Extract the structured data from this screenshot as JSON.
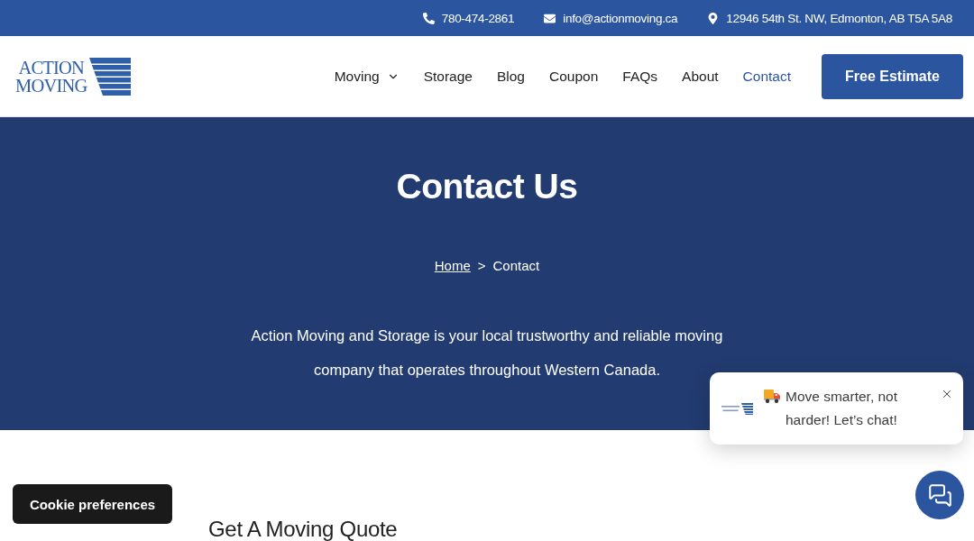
{
  "top_bar": {
    "contacts": [
      {
        "kind": "phone",
        "text": "780-474-2861"
      },
      {
        "kind": "email",
        "text": "info@actionmoving.ca"
      },
      {
        "kind": "location",
        "text": "12946 54th St. NW, Edmonton, AB T5A 5A8"
      }
    ]
  },
  "header": {
    "logo": {
      "lines": [
        "ACTION",
        "MOVING"
      ]
    },
    "nav": [
      {
        "label": "Moving",
        "dropdown": true,
        "selected": false
      },
      {
        "label": "Storage",
        "dropdown": false,
        "selected": false
      },
      {
        "label": "Blog",
        "dropdown": false,
        "selected": false
      },
      {
        "label": "Coupon",
        "dropdown": false,
        "selected": false
      },
      {
        "label": "FAQs",
        "dropdown": false,
        "selected": false
      },
      {
        "label": "About",
        "dropdown": false,
        "selected": false
      },
      {
        "label": "Contact",
        "dropdown": false,
        "selected": true
      }
    ],
    "cta": "Free Estimate"
  },
  "hero": {
    "title": "Contact Us",
    "breadcrumb": [
      {
        "kind": "link",
        "label": "Home"
      },
      {
        "kind": "separator",
        "label": ">"
      },
      {
        "kind": "current",
        "label": "Contact"
      }
    ],
    "intro": "Action Moving and Storage is your local trustworthy and reliable moving company that operates throughout Western Canada."
  },
  "quote_section": {
    "heading": "Get A Moving Quote"
  },
  "cookie_button": {
    "label": "Cookie preferences"
  },
  "chat": {
    "message": "Move smarter, not harder! Let’s chat!"
  }
}
